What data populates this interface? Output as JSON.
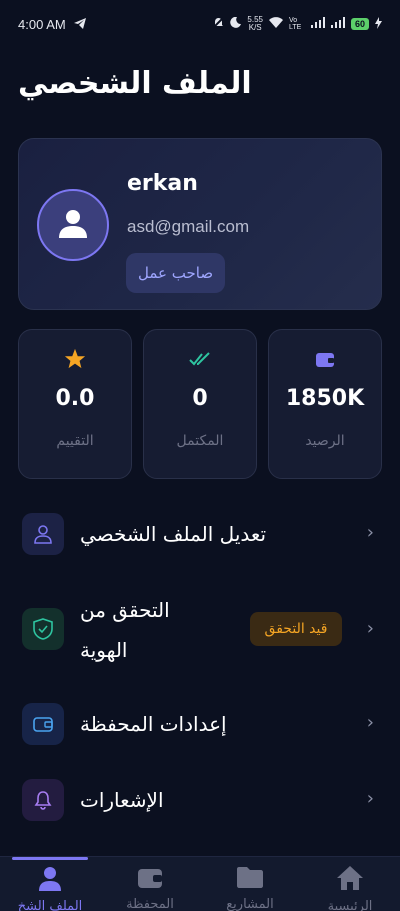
{
  "status_bar": {
    "time": "4:00 AM",
    "speed": "5.55\nK/S",
    "network": "Vo LTE",
    "battery": "60"
  },
  "page": {
    "title": "الملف الشخصي"
  },
  "profile": {
    "username": "erkan",
    "email": "asd@gmail.com",
    "role": "صاحب عمل"
  },
  "stats": [
    {
      "value": "0.0",
      "label": "التقييم",
      "icon": "star-icon",
      "color": "#f5a524"
    },
    {
      "value": "0",
      "label": "المكتمل",
      "icon": "double-check-icon",
      "color": "#2ec4a0"
    },
    {
      "value": "1850K",
      "label": "الرصيد",
      "icon": "wallet-icon",
      "color": "#7d77f2"
    }
  ],
  "menu": [
    {
      "label": "تعديل الملف الشخصي",
      "icon": "user-icon"
    },
    {
      "label_line1": "التحقق من",
      "label_line2": "الهوية",
      "icon": "shield-check-icon",
      "badge": "قيد التحقق"
    },
    {
      "label": "إعدادات المحفظة",
      "icon": "wallet-icon"
    },
    {
      "label": "الإشعارات",
      "icon": "bell-icon"
    }
  ],
  "bottom_nav": [
    {
      "label": "الملف الشخ",
      "icon": "user-icon",
      "active": true
    },
    {
      "label": "المحفظة",
      "icon": "wallet-icon",
      "active": false
    },
    {
      "label": "المشاريع",
      "icon": "folder-icon",
      "active": false
    },
    {
      "label": "الرئيسية",
      "icon": "home-icon",
      "active": false
    }
  ],
  "colors": {
    "background": "#0b1020",
    "accent": "#7d77f2",
    "warning": "#f5a524",
    "success": "#2ec4a0"
  }
}
